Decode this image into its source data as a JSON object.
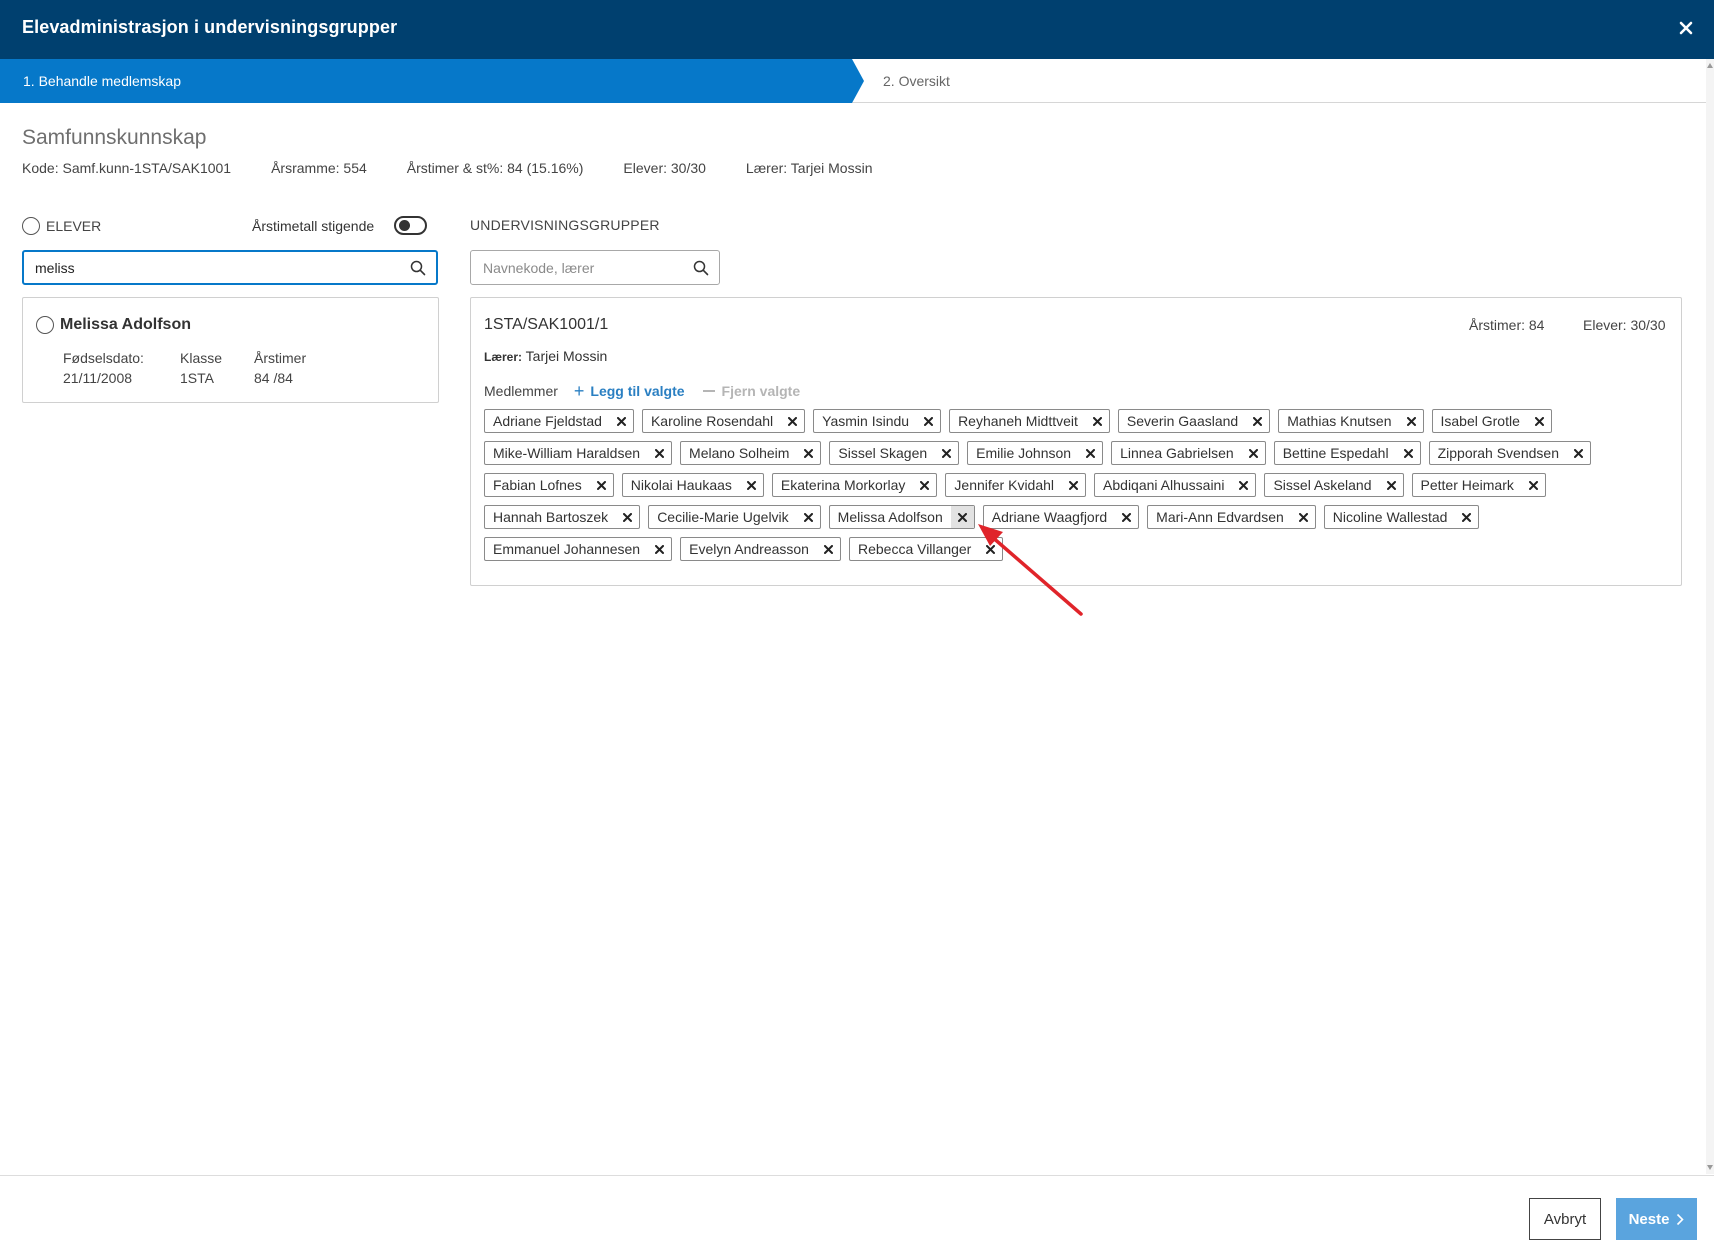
{
  "window": {
    "title": "Elevadministrasjon i undervisningsgrupper"
  },
  "steps": {
    "step1": "1. Behandle medlemskap",
    "step2": "2. Oversikt"
  },
  "subject": {
    "title": "Samfunnskunnskap",
    "code": "Kode: Samf.kunn-1STA/SAK1001",
    "yearly_frame": "Årsramme: 554",
    "hours_pct": "Årstimer & st%: 84 (15.16%)",
    "students": "Elever: 30/30",
    "teacher": "Lærer: Tarjei Mossin"
  },
  "students_panel": {
    "header": "ELEVER",
    "sort_label": "Årstimetall stigende",
    "sort_toggle_on": false,
    "search_value": "meliss",
    "results": [
      {
        "name": "Melissa Adolfson",
        "dob_label": "Fødselsdato:",
        "dob": "21/11/2008",
        "class_label": "Klasse",
        "class": "1STA",
        "hours_label": "Årstimer",
        "hours": "84 /84"
      }
    ]
  },
  "groups_panel": {
    "header": "UNDERVISNINGSGRUPPER",
    "search_placeholder": "Navnekode, lærer",
    "group": {
      "name": "1STA/SAK1001/1",
      "hours": "Årstimer: 84",
      "students": "Elever: 30/30",
      "teacher_label": "Lærer:",
      "teacher": "Tarjei Mossin",
      "members_label": "Medlemmer",
      "add_label": "Legg til valgte",
      "remove_label": "Fjern valgte",
      "members": [
        "Adriane Fjeldstad",
        "Karoline Rosendahl",
        "Yasmin Isindu",
        "Reyhaneh Midttveit",
        "Severin Gaasland",
        "Mathias Knutsen",
        "Isabel Grotle",
        "Mike-William Haraldsen",
        "Melano Solheim",
        "Sissel Skagen",
        "Emilie Johnson",
        "Linnea Gabrielsen",
        "Bettine Espedahl",
        "Zipporah Svendsen",
        "Fabian Lofnes",
        "Nikolai Haukaas",
        "Ekaterina Morkorlay",
        "Jennifer Kvidahl",
        "Abdiqani Alhussaini",
        "Sissel Askeland",
        "Petter Heimark",
        "Hannah Bartoszek",
        "Cecilie-Marie Ugelvik",
        "Melissa Adolfson",
        "Adriane Waagfjord",
        "Mari-Ann Edvardsen",
        "Nicoline Wallestad",
        "Emmanuel Johannesen",
        "Evelyn Andreasson",
        "Rebecca Villanger"
      ],
      "hovered_member_remove": "Melissa Adolfson"
    }
  },
  "footer": {
    "cancel": "Avbryt",
    "next": "Neste"
  },
  "colors": {
    "header_bg": "#00406f",
    "step_active": "#0678c9",
    "link": "#2a7fc2",
    "next_button": "#5aa4de",
    "annotation_arrow": "#e0242a"
  },
  "icons": {
    "close": "close-icon",
    "search": "search-icon",
    "chip_remove": "x-icon",
    "add": "plus-icon",
    "remove": "minus-icon",
    "next": "chevron-right-icon",
    "annotation": "red-arrow-icon"
  }
}
